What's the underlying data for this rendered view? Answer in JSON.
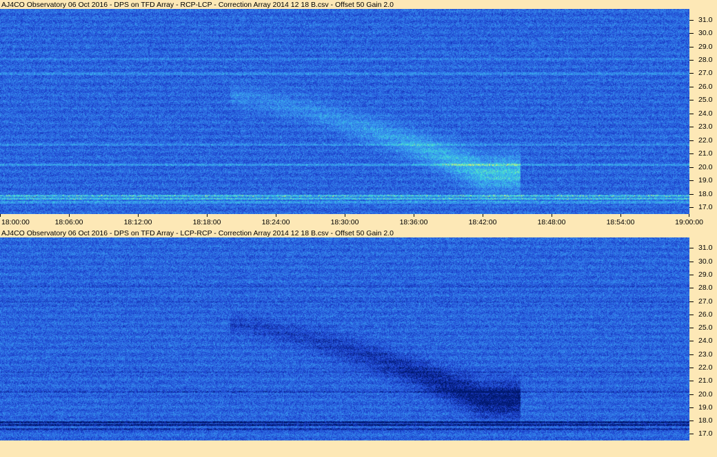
{
  "panels": [
    {
      "title": "AJ4CO Observatory 06 Oct 2016 - DPS on TFD Array - RCP-LCP - Correction Array 2014 12 18 B.csv - Offset 50  Gain 2.0",
      "polarity": "bright"
    },
    {
      "title": "AJ4CO Observatory 06 Oct 2016 - DPS on TFD Array - LCP-RCP - Correction Array 2014 12 18 B.csv - Offset 50  Gain 2.0",
      "polarity": "dark"
    }
  ],
  "chart_data": {
    "type": "heatmap",
    "x_axis": {
      "tick_labels": [
        "18:00:00",
        "18:06:00",
        "18:12:00",
        "18:18:00",
        "18:24:00",
        "18:30:00",
        "18:36:00",
        "18:42:00",
        "18:48:00",
        "18:54:00",
        "19:00:00"
      ],
      "range": [
        "18:00:00",
        "19:00:00"
      ]
    },
    "y_axis": {
      "tick_labels": [
        "31.0",
        "30.0",
        "29.0",
        "28.0",
        "27.0",
        "26.0",
        "25.0",
        "24.0",
        "23.0",
        "22.0",
        "21.0",
        "20.0",
        "19.0",
        "18.0",
        "17.0"
      ],
      "range": [
        16.5,
        31.8
      ],
      "position": "right"
    },
    "colormap": [
      "#00186e",
      "#1a3cc8",
      "#2f6fe6",
      "#39a4f0",
      "#3fe0d8",
      "#f0f060"
    ],
    "features": [
      {
        "kind": "drifting emission arc",
        "time_start": "18:20:00",
        "time_end": "18:42:00",
        "freq_start_mhz": 25.3,
        "freq_end_mhz": 19.6
      }
    ]
  }
}
